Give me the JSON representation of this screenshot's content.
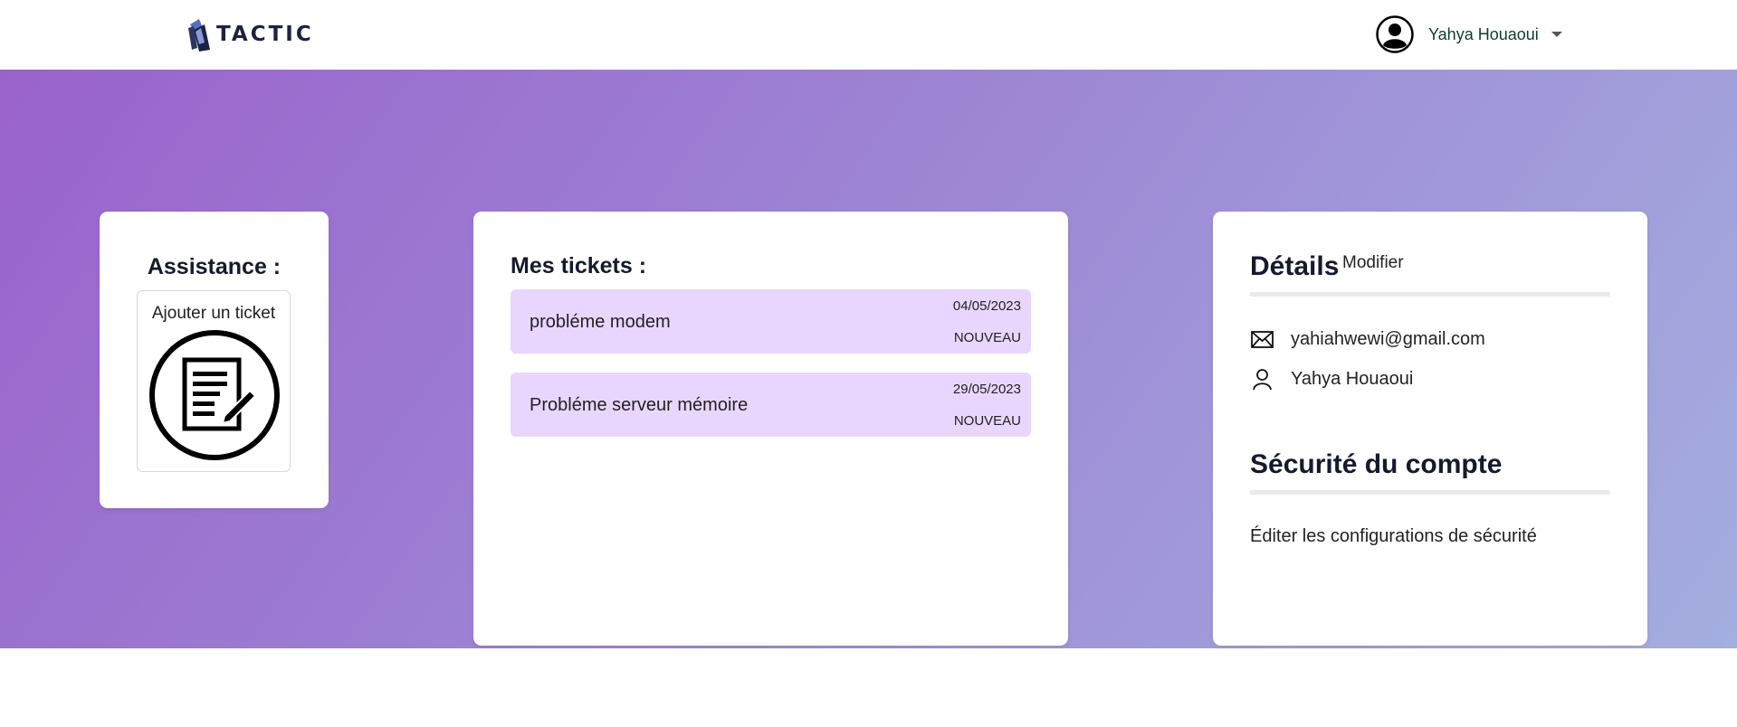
{
  "brand": {
    "logo_text": "TACTIC"
  },
  "header": {
    "user_name": "Yahya Houaoui",
    "avatar_icon": "user-circle-icon",
    "dropdown_icon": "caret-down-icon"
  },
  "colors": {
    "gradient_start": "#9a63cc",
    "gradient_end": "#a4aedf",
    "ticket_background": "#e9d6fe"
  },
  "assistance": {
    "title": "Assistance :",
    "add_ticket_label": "Ajouter un ticket",
    "add_ticket_icon": "document-edit-icon"
  },
  "tickets": {
    "title": "Mes tickets :",
    "items": [
      {
        "subject": "probléme modem",
        "date": "04/05/2023",
        "status": "NOUVEAU"
      },
      {
        "subject": "Probléme serveur mémoire",
        "date": "29/05/2023",
        "status": "NOUVEAU"
      }
    ]
  },
  "details": {
    "title": "Détails",
    "edit_label": "Modifier",
    "email": "yahiahwewi@gmail.com",
    "email_icon": "envelope-icon",
    "name": "Yahya Houaoui",
    "name_icon": "person-icon"
  },
  "security": {
    "title": "Sécurité du compte",
    "edit_label": "Éditer les configurations de sécurité"
  }
}
